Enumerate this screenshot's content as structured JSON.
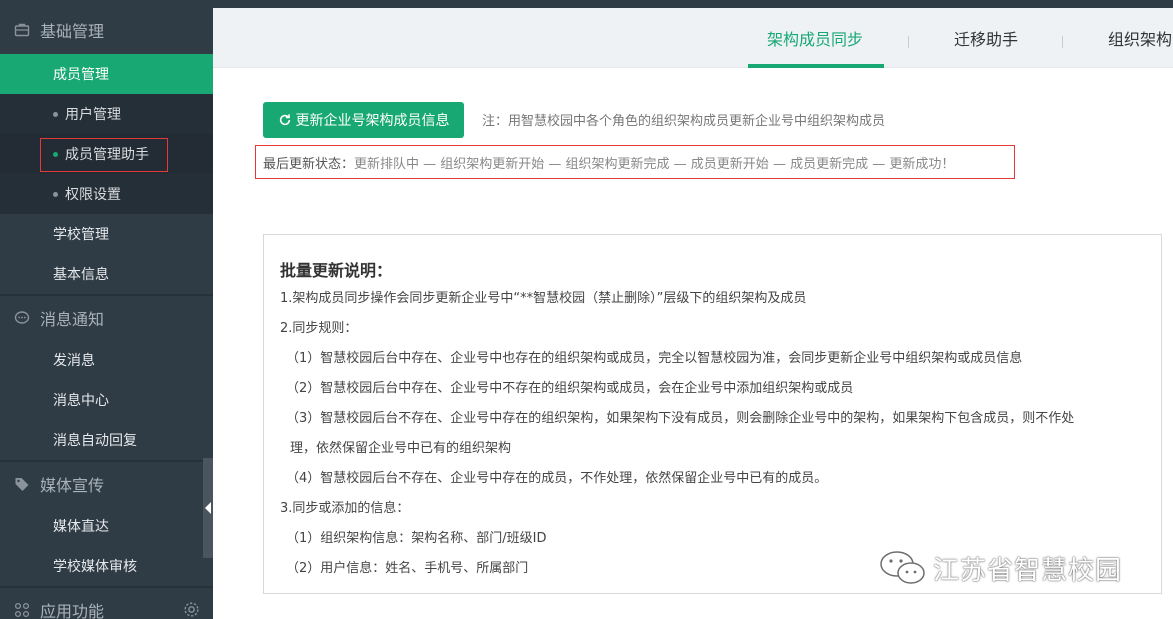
{
  "sidebar": {
    "groups": [
      {
        "label": "基础管理",
        "icon": "briefcase-icon"
      },
      {
        "label": "消息通知",
        "icon": "chat-icon"
      },
      {
        "label": "媒体宣传",
        "icon": "tag-icon"
      },
      {
        "label": "应用功能",
        "icon": "apps-icon"
      }
    ],
    "items": {
      "member_mgmt": "成员管理",
      "user_mgmt": "用户管理",
      "member_helper": "成员管理助手",
      "permission": "权限设置",
      "school_mgmt": "学校管理",
      "basic_info": "基本信息",
      "send_msg": "发消息",
      "msg_center": "消息中心",
      "auto_reply": "消息自动回复",
      "media_direct": "媒体直达",
      "media_review": "学校媒体审核"
    },
    "accent_color": "#18a874",
    "bg_color": "#2f3b45"
  },
  "tabs": [
    {
      "label": "架构成员同步",
      "active": true
    },
    {
      "label": "迁移助手",
      "active": false
    },
    {
      "label": "组织架构",
      "active": false
    }
  ],
  "main": {
    "update_button": "更新企业号架构成员信息",
    "note": "注：用智慧校园中各个角色的组织架构成员更新企业号中组织架构成员",
    "status_label": "最后更新状态：",
    "status_text": "更新排队中 — 组织架构更新开始 — 组织架构更新完成 — 成员更新开始 — 成员更新完成 — 更新成功！"
  },
  "description": {
    "title": "批量更新说明：",
    "lines": [
      "1.架构成员同步操作会同步更新企业号中“**智慧校园（禁止删除）”层级下的组织架构及成员",
      "2.同步规则：",
      "（1）智慧校园后台中存在、企业号中也存在的组织架构或成员，完全以智慧校园为准，会同步更新企业号中组织架构或成员信息",
      "（2）智慧校园后台中存在、企业号中不存在的组织架构或成员，会在企业号中添加组织架构或成员",
      "（3）智慧校园后台不存在、企业号中存在的组织架构，如果架构下没有成员，则会删除企业号中的架构，如果架构下包含成员，则不作处",
      "理，依然保留企业号中已有的组织架构",
      "（4）智慧校园后台不存在、企业号中存在的成员，不作处理，依然保留企业号中已有的成员。",
      "3.同步或添加的信息：",
      "（1）组织架构信息：架构名称、部门/班级ID",
      "（2）用户信息：姓名、手机号、所属部门"
    ]
  },
  "watermark": {
    "text": "江苏省智慧校园",
    "icon": "wechat-icon"
  }
}
